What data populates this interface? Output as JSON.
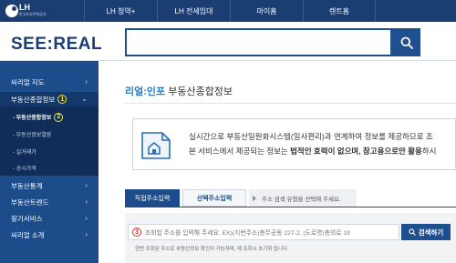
{
  "topbar": {
    "logo_text": "LH",
    "logo_sub": "한국토지주택공사",
    "nav": [
      "LH 청약+",
      "LH 전세임대",
      "마이홈",
      "렌트홈"
    ]
  },
  "header": {
    "brand": "SEE:REAL",
    "search_placeholder": ""
  },
  "sidebar": {
    "items": [
      {
        "label": "씨리얼 지도"
      },
      {
        "label": "부동산종합정보",
        "badge": "1"
      },
      {
        "label": "부동산통계"
      },
      {
        "label": "부동산트렌드"
      },
      {
        "label": "찾기서비스"
      },
      {
        "label": "씨리얼 소개"
      }
    ],
    "sub_items": [
      {
        "label": "- 부동산종합정보",
        "badge": "2"
      },
      {
        "label": "- 부동산정보열람"
      },
      {
        "label": "- 실거래가"
      },
      {
        "label": "- 공시가격"
      }
    ]
  },
  "main": {
    "title_accent": "리얼:인포",
    "title_rest": " 부동산종합정보",
    "info_line1": "실시간으로 부동산일원화시스템(일사편리)과 연계하여 정보를 제공하므로 조",
    "info_line2_pre": "본 서비스에서 제공되는 정보는 ",
    "info_line2_bold": "법적인 효력이 없으며, 참고용으로만 활용",
    "info_line2_post": "하시",
    "tabs": {
      "tab1": "직접주소입력",
      "tab2": "선택주소입력",
      "hint": "주소 검색 유형을 선택해 주세요."
    },
    "address": {
      "badge": "3",
      "placeholder": "조회할 주소를 입력해 주세요. EX)(지번주소)충무공동 227-2, (도로명)충의로 19",
      "button": "검색하기",
      "note": "현번 조회된 주소로 부동산정보 확인이 가능하며, 재 조회시 초기화 됩니다."
    }
  },
  "colors": {
    "navy": "#1a3d72",
    "sidebar": "#1c4c8a",
    "accent_blue": "#2a7dc9",
    "badge_yellow": "#f6e21a",
    "badge_red": "#e03131"
  }
}
